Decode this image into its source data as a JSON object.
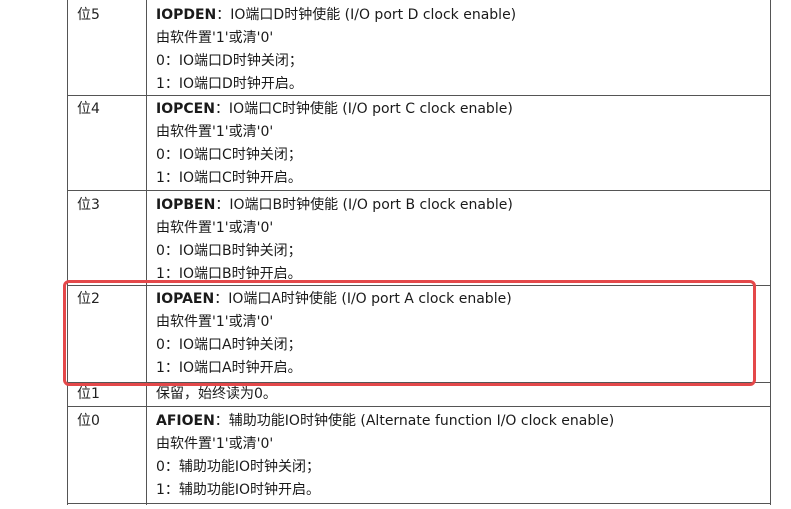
{
  "rows": [
    {
      "bit": "位5",
      "name": "IOPDEN",
      "title": "：IO端口D时钟使能 (I/O port D clock enable)",
      "line1": "由软件置'1'或清'0'",
      "line2": "0：IO端口D时钟关闭；",
      "line3": "1：IO端口D时钟开启。"
    },
    {
      "bit": "位4",
      "name": "IOPCEN",
      "title": "：IO端口C时钟使能 (I/O port C clock enable)",
      "line1": "由软件置'1'或清'0'",
      "line2": "0：IO端口C时钟关闭；",
      "line3": "1：IO端口C时钟开启。"
    },
    {
      "bit": "位3",
      "name": "IOPBEN",
      "title": "：IO端口B时钟使能 (I/O port B clock enable)",
      "line1": "由软件置'1'或清'0'",
      "line2": "0：IO端口B时钟关闭；",
      "line3": "1：IO端口B时钟开启。"
    },
    {
      "bit": "位2",
      "name": "IOPAEN",
      "title": "：IO端口A时钟使能 (I/O port A clock enable)",
      "line1": "由软件置'1'或清'0'",
      "line2": "0：IO端口A时钟关闭；",
      "line3": "1：IO端口A时钟开启。"
    },
    {
      "bit": "位1",
      "reserved": "保留，始终读为0。"
    },
    {
      "bit": "位0",
      "name": "AFIOEN",
      "title": "：辅助功能IO时钟使能 (Alternate function I/O clock enable)",
      "line1": "由软件置'1'或清'0'",
      "line2": "0：辅助功能IO时钟关闭；",
      "line3": "1：辅助功能IO时钟开启。"
    }
  ],
  "highlight_color": "#e4484a",
  "border_color": "#555555"
}
